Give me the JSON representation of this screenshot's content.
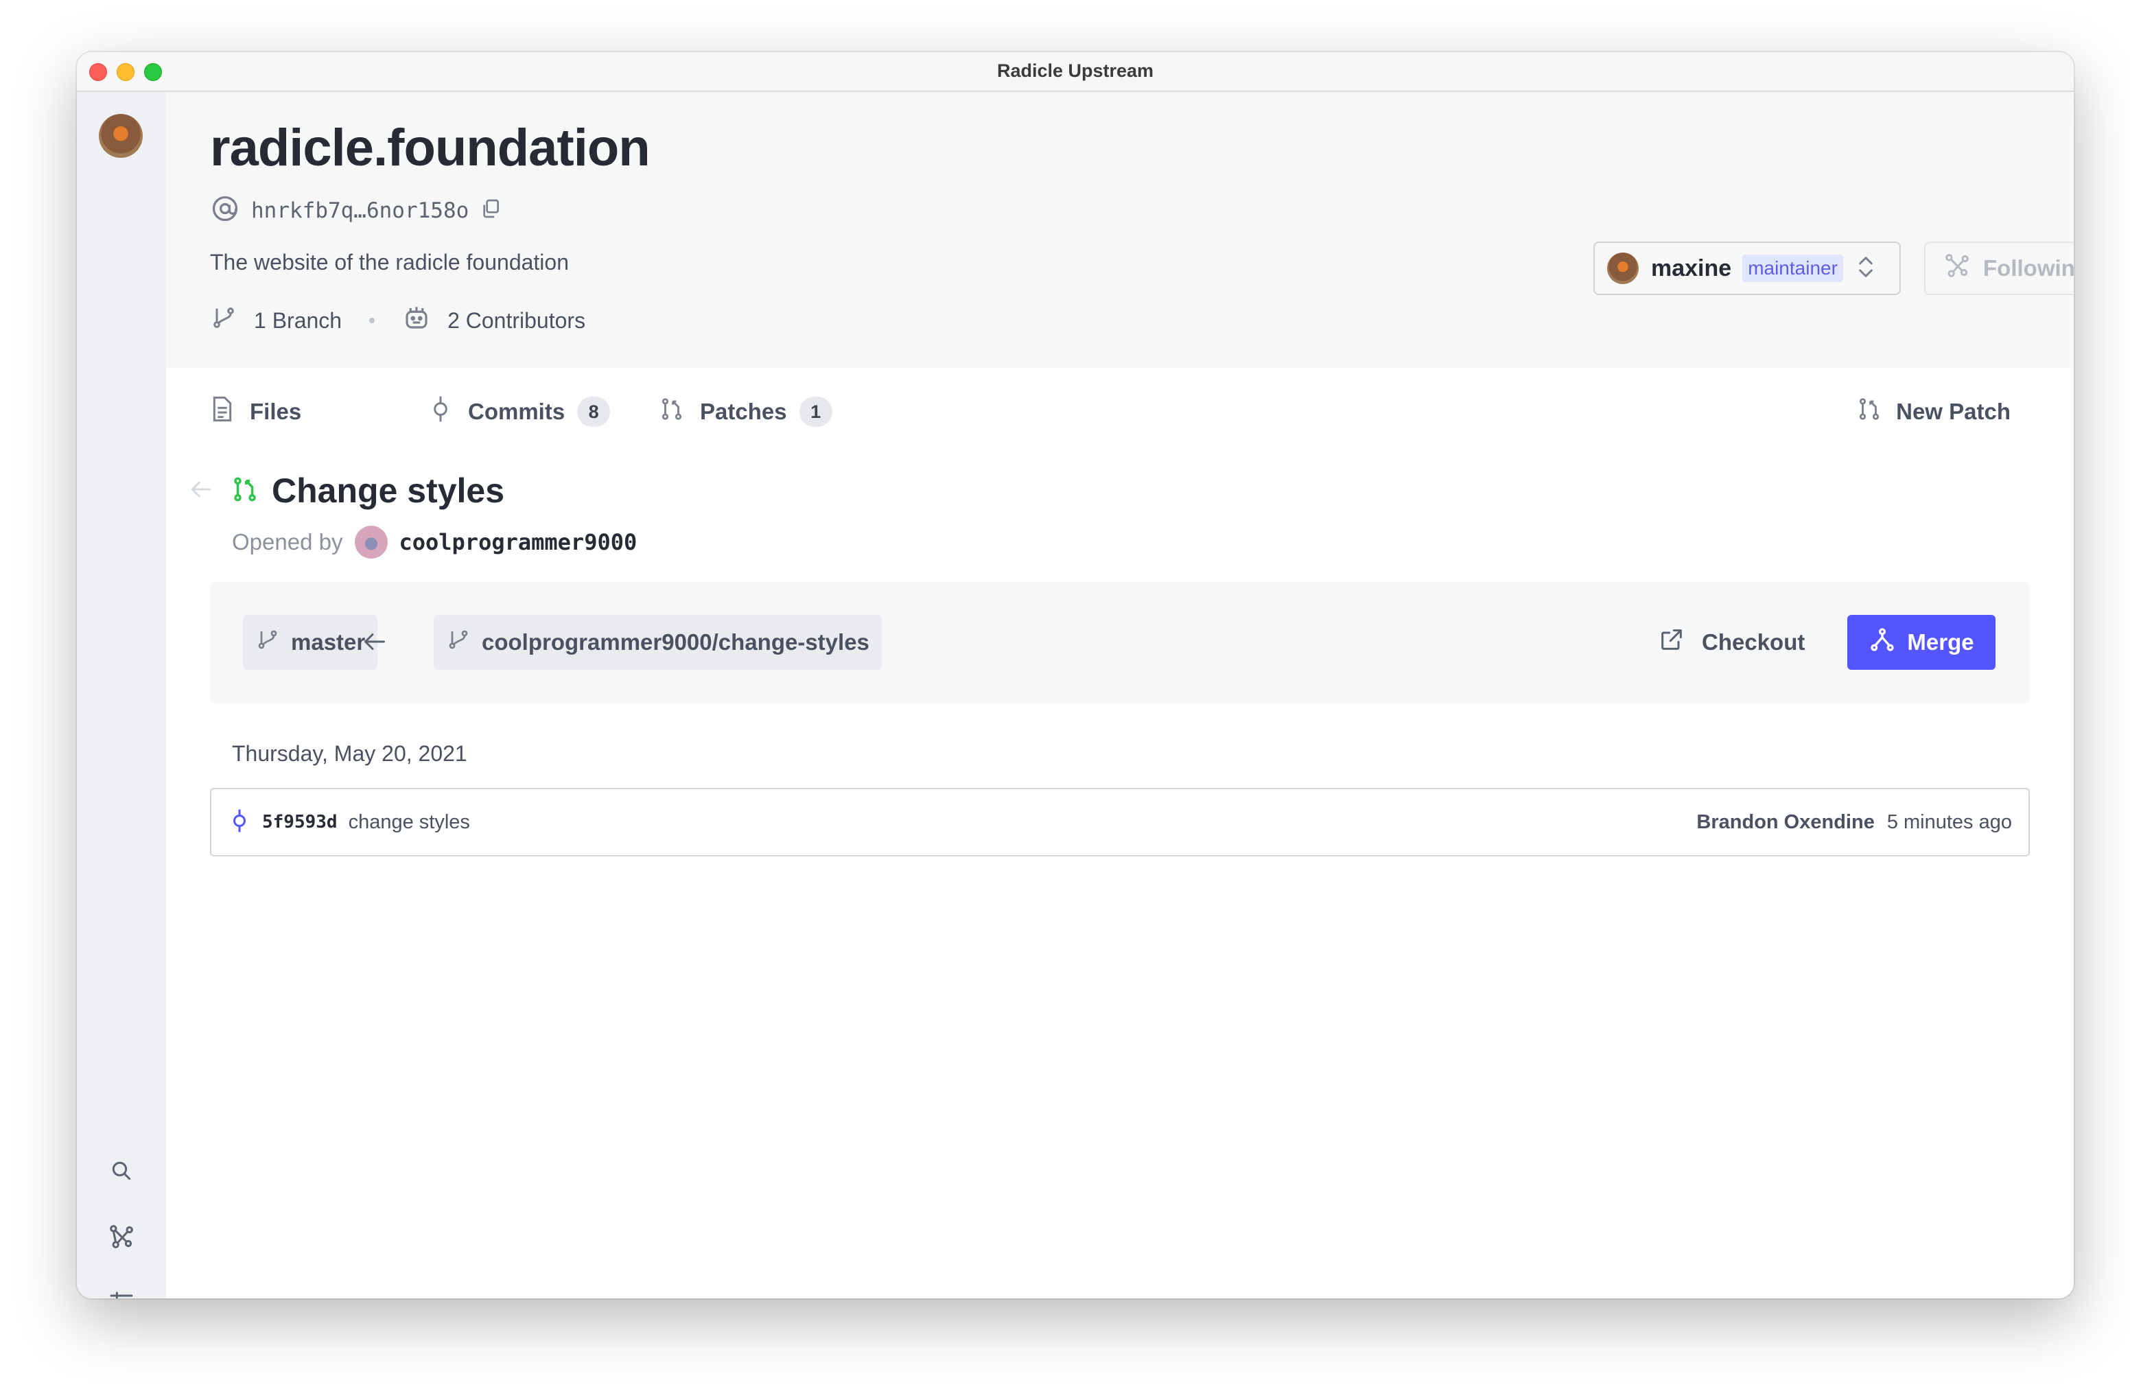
{
  "window": {
    "title": "Radicle Upstream"
  },
  "project": {
    "name": "radicle.foundation",
    "urn": "hnrkfb7q…6nor158o",
    "description": "The website of the radicle foundation",
    "branches_label": "1 Branch",
    "contributors_label": "2 Contributors"
  },
  "peer": {
    "name": "maxine",
    "role": "maintainer"
  },
  "follow": {
    "label": "Following"
  },
  "tabs": [
    {
      "label": "Files"
    },
    {
      "label": "Commits",
      "count": "8"
    },
    {
      "label": "Patches",
      "count": "1"
    }
  ],
  "new_patch": {
    "label": "New Patch"
  },
  "patch": {
    "title": "Change styles",
    "opened_by_label": "Opened by",
    "author": "coolprogrammer9000",
    "target_branch": "master",
    "source_branch": "coolprogrammer9000/change-styles",
    "checkout_label": "Checkout",
    "merge_label": "Merge"
  },
  "commits": {
    "date_header": "Thursday, May 20, 2021",
    "items": [
      {
        "hash": "5f9593d",
        "message": "change styles",
        "author": "Brandon Oxendine",
        "time": "5 minutes ago"
      }
    ]
  },
  "colors": {
    "accent": "#5555ff",
    "patch_open": "#2ec44b",
    "role_badge_bg": "#e1e4fd",
    "role_badge_text": "#5b5ee6"
  },
  "icons": {
    "sidebar": [
      "search-icon",
      "network-icon",
      "settings-sliders-icon"
    ],
    "urn": "at-sign-icon",
    "copy": "copy-icon"
  }
}
